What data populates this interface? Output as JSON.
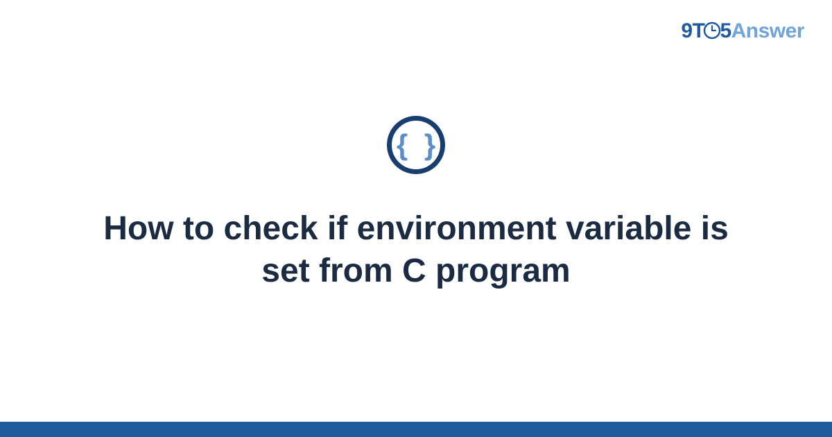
{
  "logo": {
    "prefix": "9T",
    "middle": "5",
    "suffix": "Answer"
  },
  "category": {
    "icon_name": "code-braces",
    "glyph": "{ }"
  },
  "title": "How to check if environment variable is set from C program",
  "colors": {
    "brand_primary": "#1f5a9e",
    "brand_secondary": "#6fa3d9",
    "icon_ring": "#173e6e",
    "icon_glyph": "#5a8fc9",
    "title_text": "#1a2b42"
  }
}
